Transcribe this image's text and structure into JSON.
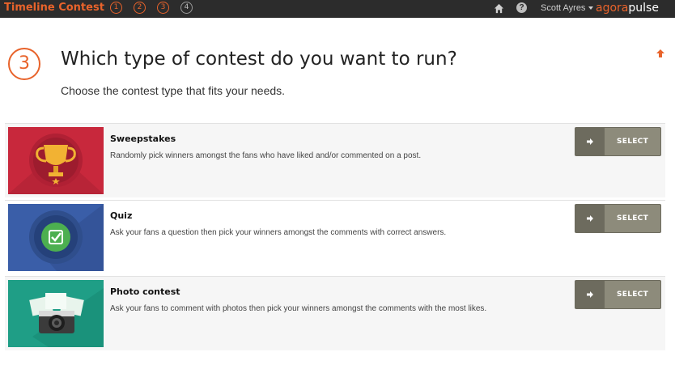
{
  "topbar": {
    "brand": "Timeline Contest",
    "steps": [
      "1",
      "2",
      "3",
      "4"
    ],
    "user_name": "Scott Ayres",
    "logo_part1": "agora",
    "logo_part2": "pulse",
    "icons": {
      "home": "home-icon",
      "help": "help-icon",
      "caret": "caret-down-icon"
    }
  },
  "heading": {
    "step_number": "3",
    "title": "Which type of contest do you want to run?",
    "subtitle": "Choose the contest type that fits your needs."
  },
  "contest_types": [
    {
      "title": "Sweepstakes",
      "description": "Randomly pick winners amongst the fans who have liked and/or commented on a post.",
      "button_label": "SELECT",
      "icon": "trophy-icon",
      "color": "#c8283c"
    },
    {
      "title": "Quiz",
      "description": "Ask your fans a question then pick your winners amongst the comments with correct answers.",
      "button_label": "SELECT",
      "icon": "checkmark-badge-icon",
      "color": "#3a5ea8"
    },
    {
      "title": "Photo contest",
      "description": "Ask your fans to comment with photos then pick your winners amongst the comments with the most likes.",
      "button_label": "SELECT",
      "icon": "camera-icon",
      "color": "#1f9e86"
    }
  ],
  "colors": {
    "accent": "#e8632b",
    "topbar": "#2c2c2c",
    "button": "#8d8b7b"
  }
}
